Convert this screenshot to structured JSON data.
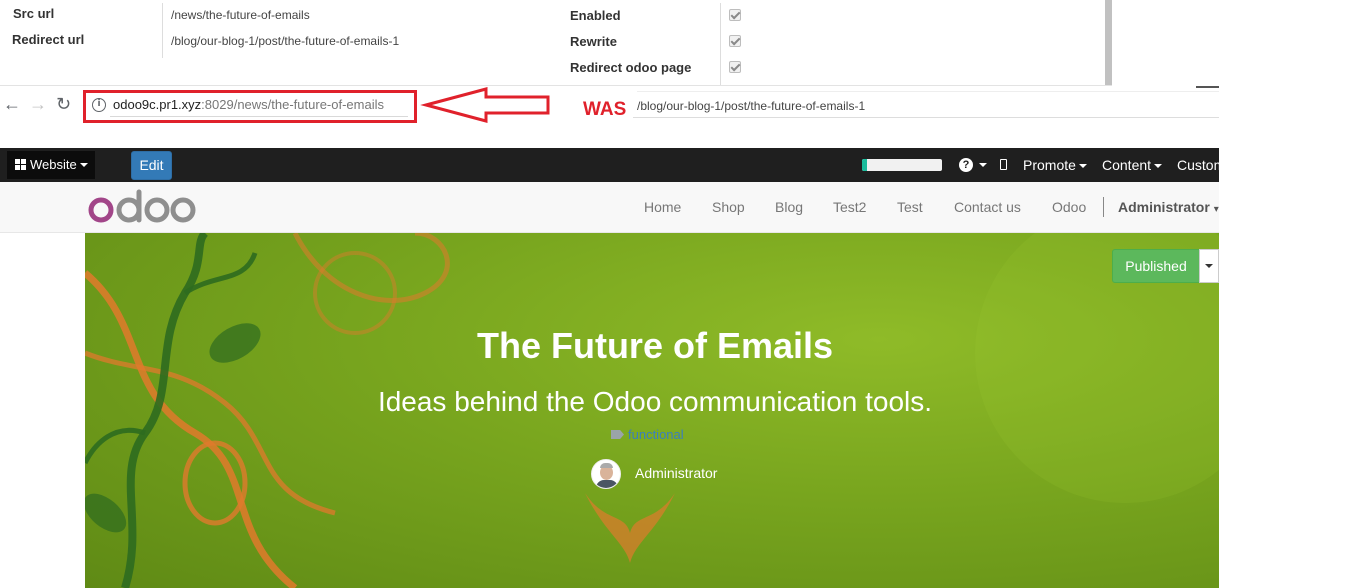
{
  "redirect_form": {
    "src_url_label": "Src url",
    "src_url_value": "/news/the-future-of-emails",
    "redirect_url_label": "Redirect url",
    "redirect_url_value": "/blog/our-blog-1/post/the-future-of-emails-1",
    "enabled_label": "Enabled",
    "enabled_checked": true,
    "rewrite_label": "Rewrite",
    "rewrite_checked": true,
    "redirect_odoo_page_label": "Redirect odoo page",
    "redirect_odoo_page_checked": true
  },
  "browser": {
    "url_host": "odoo9c.pr1.xyz",
    "url_rest": ":8029/news/the-future-of-emails",
    "back_icon": "arrow-left-icon",
    "forward_icon": "arrow-right-icon",
    "reload_icon": "reload-icon",
    "info_icon": "info-icon"
  },
  "annotation": {
    "was_label": "WAS",
    "was_url": "/blog/our-blog-1/post/the-future-of-emails-1",
    "highlight_color": "#e0212b"
  },
  "editbar": {
    "website_label": "Website",
    "edit_label": "Edit",
    "progress_fraction": 0.06,
    "promote_label": "Promote",
    "content_label": "Content",
    "customize_label": "Custom"
  },
  "site_nav": {
    "logo_text": "odoo",
    "items": [
      "Home",
      "Shop",
      "Blog",
      "Test2",
      "Test",
      "Contact us",
      "Odoo"
    ],
    "user_label": "Administrator"
  },
  "hero": {
    "published_label": "Published",
    "title": "The Future of Emails",
    "subtitle": "Ideas behind the Odoo communication tools.",
    "tag": "functional",
    "author": "Administrator"
  },
  "colors": {
    "edit_button": "#337ab7",
    "published_button": "#5cb85c",
    "editbar_bg": "#1f1f1f",
    "hero_green": "#78a51e"
  }
}
